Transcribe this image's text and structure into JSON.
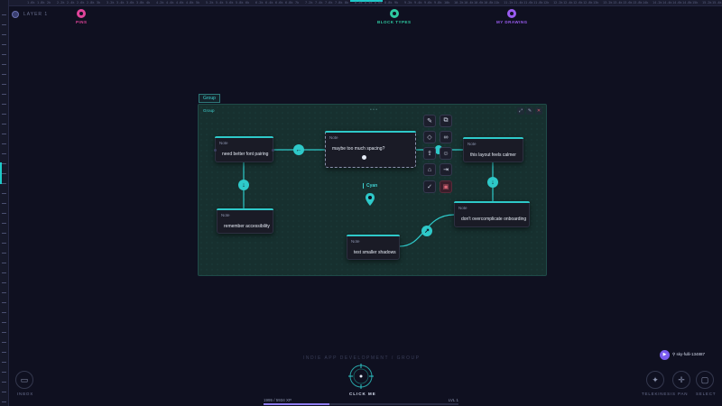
{
  "layer": {
    "label": "LAYER 1"
  },
  "ruler_ticks": [
    "1.6k",
    "1.8k",
    "2k",
    "2.2k",
    "2.4k",
    "2.6k",
    "2.8k",
    "3k",
    "3.2k",
    "3.4k",
    "3.6k",
    "3.8k",
    "4k",
    "4.2k",
    "4.4k",
    "4.6k",
    "4.8k",
    "5k",
    "5.2k",
    "5.4k",
    "5.6k",
    "5.8k",
    "6k",
    "6.2k",
    "6.4k",
    "6.6k",
    "6.8k",
    "7k",
    "7.2k",
    "7.4k",
    "7.6k",
    "7.8k",
    "8k",
    "8.2k",
    "8.4k",
    "8.6k",
    "8.8k",
    "9k",
    "9.2k",
    "9.4k",
    "9.6k",
    "9.8k",
    "10k",
    "10.2k",
    "10.4k",
    "10.6k",
    "10.8k",
    "11k",
    "11.2k",
    "11.4k",
    "11.6k",
    "11.8k",
    "12k",
    "12.2k",
    "12.4k",
    "12.6k",
    "12.8k",
    "13k",
    "13.2k",
    "13.4k",
    "13.6k",
    "13.8k",
    "14k",
    "14.2k",
    "14.4k",
    "14.6k",
    "14.8k",
    "15k",
    "15.2k",
    "15.4k"
  ],
  "top_pins": [
    {
      "label": "PINS",
      "color": "#e0449a",
      "icon": "pin-icon"
    },
    {
      "label": "BLOCK TYPES",
      "color": "#2ec9a0",
      "icon": "pin-icon"
    },
    {
      "label": "MY DRAWING",
      "color": "#9a5cf0",
      "icon": "pin-icon"
    }
  ],
  "group": {
    "tab": "Group",
    "title": "Group",
    "dots": "• • •"
  },
  "notes": [
    {
      "header": "Note",
      "text": "need better font pairing"
    },
    {
      "header": "Note",
      "text": "maybe too much spacing?"
    },
    {
      "header": "Note",
      "text": "this layout feels calmer"
    },
    {
      "header": "Note",
      "text": "remember accessibility"
    },
    {
      "header": "Note",
      "text": "don't overcomplicate onboarding"
    },
    {
      "header": "Note",
      "text": "test smaller shadows"
    }
  ],
  "toolbar_icons": [
    "pencil-icon",
    "copy-icon",
    "tag-icon",
    "link-icon",
    "share-icon",
    "users-icon",
    "lock-icon",
    "exit-icon",
    "brush-icon",
    "trash-icon"
  ],
  "cyan_pin": {
    "label": "Cyan"
  },
  "footer": {
    "title": "INDIE APP DEVELOPMENT / GROUP",
    "click_label": "CLICK ME",
    "xp_text": "1995 / 5934 XP",
    "level": "LVL 1",
    "xp_progress": 0.34
  },
  "left_button": {
    "label": "INBOX"
  },
  "right_buttons": [
    {
      "label": "TELEKINESIS",
      "icon": "sparkle-icon"
    },
    {
      "label": "PAN",
      "icon": "move-icon"
    },
    {
      "label": "SELECT",
      "icon": "select-icon"
    }
  ],
  "user": {
    "name": "sky-fulli-134887"
  },
  "colors": {
    "accent": "#2ec9c9",
    "background": "#0f1020",
    "xp": "#8f7cf0",
    "danger": "#e06a7a"
  }
}
